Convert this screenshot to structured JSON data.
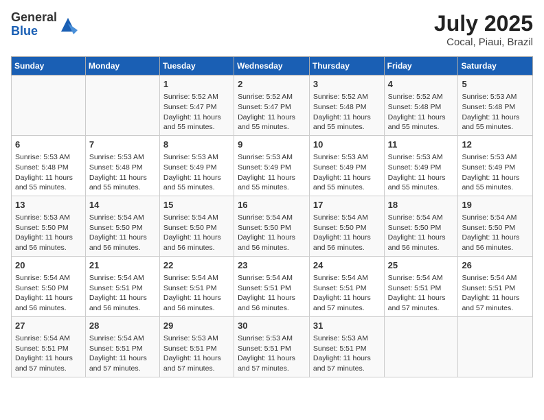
{
  "logo": {
    "general": "General",
    "blue": "Blue"
  },
  "title": {
    "month": "July 2025",
    "location": "Cocal, Piaui, Brazil"
  },
  "weekdays": [
    "Sunday",
    "Monday",
    "Tuesday",
    "Wednesday",
    "Thursday",
    "Friday",
    "Saturday"
  ],
  "weeks": [
    [
      {
        "day": "",
        "info": ""
      },
      {
        "day": "",
        "info": ""
      },
      {
        "day": "1",
        "info": "Sunrise: 5:52 AM\nSunset: 5:47 PM\nDaylight: 11 hours and 55 minutes."
      },
      {
        "day": "2",
        "info": "Sunrise: 5:52 AM\nSunset: 5:47 PM\nDaylight: 11 hours and 55 minutes."
      },
      {
        "day": "3",
        "info": "Sunrise: 5:52 AM\nSunset: 5:48 PM\nDaylight: 11 hours and 55 minutes."
      },
      {
        "day": "4",
        "info": "Sunrise: 5:52 AM\nSunset: 5:48 PM\nDaylight: 11 hours and 55 minutes."
      },
      {
        "day": "5",
        "info": "Sunrise: 5:53 AM\nSunset: 5:48 PM\nDaylight: 11 hours and 55 minutes."
      }
    ],
    [
      {
        "day": "6",
        "info": "Sunrise: 5:53 AM\nSunset: 5:48 PM\nDaylight: 11 hours and 55 minutes."
      },
      {
        "day": "7",
        "info": "Sunrise: 5:53 AM\nSunset: 5:48 PM\nDaylight: 11 hours and 55 minutes."
      },
      {
        "day": "8",
        "info": "Sunrise: 5:53 AM\nSunset: 5:49 PM\nDaylight: 11 hours and 55 minutes."
      },
      {
        "day": "9",
        "info": "Sunrise: 5:53 AM\nSunset: 5:49 PM\nDaylight: 11 hours and 55 minutes."
      },
      {
        "day": "10",
        "info": "Sunrise: 5:53 AM\nSunset: 5:49 PM\nDaylight: 11 hours and 55 minutes."
      },
      {
        "day": "11",
        "info": "Sunrise: 5:53 AM\nSunset: 5:49 PM\nDaylight: 11 hours and 55 minutes."
      },
      {
        "day": "12",
        "info": "Sunrise: 5:53 AM\nSunset: 5:49 PM\nDaylight: 11 hours and 55 minutes."
      }
    ],
    [
      {
        "day": "13",
        "info": "Sunrise: 5:53 AM\nSunset: 5:50 PM\nDaylight: 11 hours and 56 minutes."
      },
      {
        "day": "14",
        "info": "Sunrise: 5:54 AM\nSunset: 5:50 PM\nDaylight: 11 hours and 56 minutes."
      },
      {
        "day": "15",
        "info": "Sunrise: 5:54 AM\nSunset: 5:50 PM\nDaylight: 11 hours and 56 minutes."
      },
      {
        "day": "16",
        "info": "Sunrise: 5:54 AM\nSunset: 5:50 PM\nDaylight: 11 hours and 56 minutes."
      },
      {
        "day": "17",
        "info": "Sunrise: 5:54 AM\nSunset: 5:50 PM\nDaylight: 11 hours and 56 minutes."
      },
      {
        "day": "18",
        "info": "Sunrise: 5:54 AM\nSunset: 5:50 PM\nDaylight: 11 hours and 56 minutes."
      },
      {
        "day": "19",
        "info": "Sunrise: 5:54 AM\nSunset: 5:50 PM\nDaylight: 11 hours and 56 minutes."
      }
    ],
    [
      {
        "day": "20",
        "info": "Sunrise: 5:54 AM\nSunset: 5:50 PM\nDaylight: 11 hours and 56 minutes."
      },
      {
        "day": "21",
        "info": "Sunrise: 5:54 AM\nSunset: 5:51 PM\nDaylight: 11 hours and 56 minutes."
      },
      {
        "day": "22",
        "info": "Sunrise: 5:54 AM\nSunset: 5:51 PM\nDaylight: 11 hours and 56 minutes."
      },
      {
        "day": "23",
        "info": "Sunrise: 5:54 AM\nSunset: 5:51 PM\nDaylight: 11 hours and 56 minutes."
      },
      {
        "day": "24",
        "info": "Sunrise: 5:54 AM\nSunset: 5:51 PM\nDaylight: 11 hours and 57 minutes."
      },
      {
        "day": "25",
        "info": "Sunrise: 5:54 AM\nSunset: 5:51 PM\nDaylight: 11 hours and 57 minutes."
      },
      {
        "day": "26",
        "info": "Sunrise: 5:54 AM\nSunset: 5:51 PM\nDaylight: 11 hours and 57 minutes."
      }
    ],
    [
      {
        "day": "27",
        "info": "Sunrise: 5:54 AM\nSunset: 5:51 PM\nDaylight: 11 hours and 57 minutes."
      },
      {
        "day": "28",
        "info": "Sunrise: 5:54 AM\nSunset: 5:51 PM\nDaylight: 11 hours and 57 minutes."
      },
      {
        "day": "29",
        "info": "Sunrise: 5:53 AM\nSunset: 5:51 PM\nDaylight: 11 hours and 57 minutes."
      },
      {
        "day": "30",
        "info": "Sunrise: 5:53 AM\nSunset: 5:51 PM\nDaylight: 11 hours and 57 minutes."
      },
      {
        "day": "31",
        "info": "Sunrise: 5:53 AM\nSunset: 5:51 PM\nDaylight: 11 hours and 57 minutes."
      },
      {
        "day": "",
        "info": ""
      },
      {
        "day": "",
        "info": ""
      }
    ]
  ]
}
